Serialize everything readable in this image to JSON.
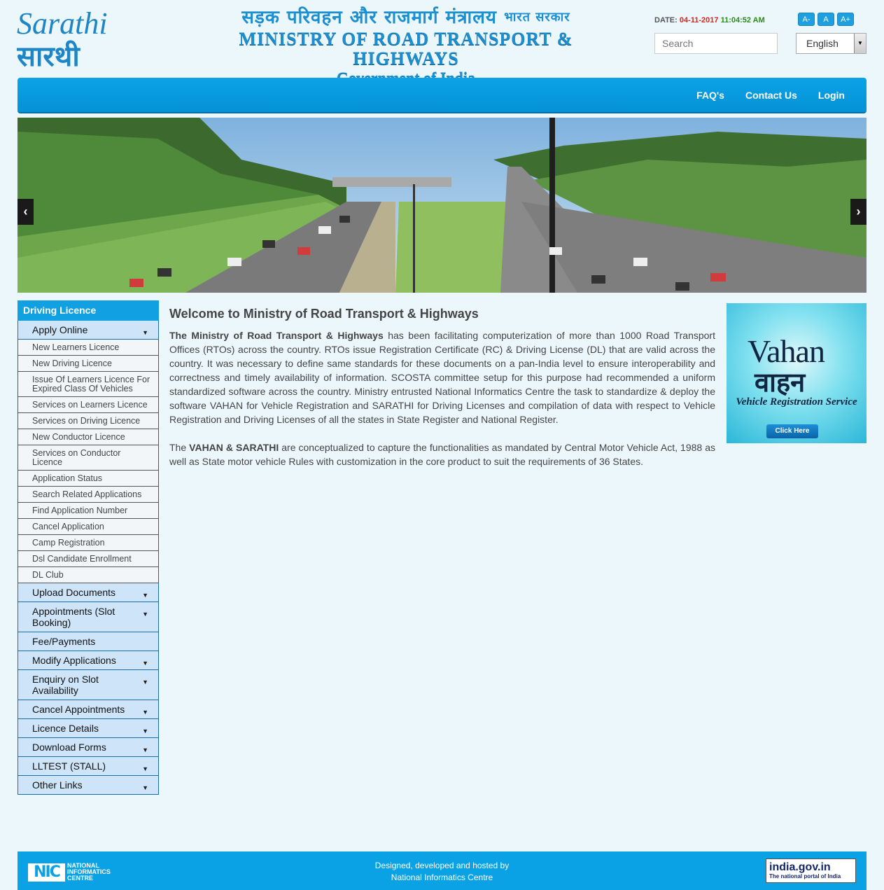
{
  "header": {
    "logo_alt": "Sarathi",
    "ministry_hindi": "सड़क परिवहन और राजमार्ग मंत्रालय",
    "ministry_hindi_small": "भारत सरकार",
    "ministry_english": "MINISTRY OF ROAD TRANSPORT & HIGHWAYS",
    "government": "Government of India",
    "date_label": "DATE:",
    "date": "04-11-2017",
    "time": "11:04:52 AM",
    "font_buttons": [
      "A-",
      "A",
      "A+"
    ],
    "search_placeholder": "Search",
    "language": "English"
  },
  "nav": {
    "items": [
      "FAQ's",
      "Contact Us",
      "Login"
    ]
  },
  "banner": {
    "prev": "‹",
    "next": "›"
  },
  "sidebar": {
    "title": "Driving Licence",
    "apply_online": "Apply Online",
    "sub_items": [
      "New Learners Licence",
      "New Driving Licence",
      "Issue Of Learners Licence For Expired Class Of Vehicles",
      "Services on Learners Licence",
      "Services on Driving Licence",
      "New Conductor Licence",
      "Services on Conductor Licence",
      "Application Status",
      "Search Related Applications",
      "Find Application Number",
      "Cancel Application",
      "Camp Registration",
      "Dsl Candidate Enrollment",
      "DL Club"
    ],
    "main_items": [
      {
        "label": "Upload Documents",
        "expandable": true
      },
      {
        "label": "Appointments (Slot Booking)",
        "expandable": true
      },
      {
        "label": "Fee/Payments",
        "expandable": false
      },
      {
        "label": "Modify Applications",
        "expandable": true
      },
      {
        "label": "Enquiry on Slot Availability",
        "expandable": true
      },
      {
        "label": "Cancel Appointments",
        "expandable": true
      },
      {
        "label": "Licence Details",
        "expandable": true
      },
      {
        "label": "Download Forms",
        "expandable": true
      },
      {
        "label": "LLTEST (STALL)",
        "expandable": true
      },
      {
        "label": "Other Links",
        "expandable": true
      }
    ]
  },
  "content": {
    "title": "Welcome to Ministry of Road Transport & Highways",
    "p1_bold": "The Ministry of Road Transport & Highways",
    "p1_rest": " has been facilitating computerization of more than 1000 Road Transport Offices (RTOs) across the country. RTOs issue Registration Certificate (RC) & Driving License (DL) that are valid across the country. It was necessary to define same standards for these documents on a pan-India level to ensure interoperability and correctness and timely availability of information. SCOSTA committee setup for this purpose had recommended a uniform standardized software across the country. Ministry entrusted National Informatics Centre the task to standardize & deploy the software VAHAN for Vehicle Registration and SARATHI for Driving Licenses and compilation of data with respect to Vehicle Registration and Driving Licenses of all the states in State Register and National Register.",
    "p2_pre": "The ",
    "p2_bold": "VAHAN & SARATHI",
    "p2_rest": " are conceptualized to capture the functionalities as mandated by Central Motor Vehicle Act, 1988 as well as State motor vehicle Rules with customization in the core product to suit the requirements of 36 States."
  },
  "vahan_ad": {
    "title_en": "Vahan",
    "title_hi": "वाहन",
    "subtitle": "Vehicle Registration Service",
    "button": "Click Here"
  },
  "footer": {
    "nic_mark": "NIC",
    "nic_text": [
      "NATIONAL",
      "INFORMATICS",
      "CENTRE"
    ],
    "line1": "Designed, developed and hosted by",
    "line2": "National Informatics Centre",
    "india_gov": "india.gov.in",
    "india_gov_sub": "The national portal of India"
  },
  "colors": {
    "primary": "#0aa2e5",
    "date": "#d9241b",
    "time": "#2a8b18",
    "sidebar_item_bg": "#cde4f9"
  }
}
